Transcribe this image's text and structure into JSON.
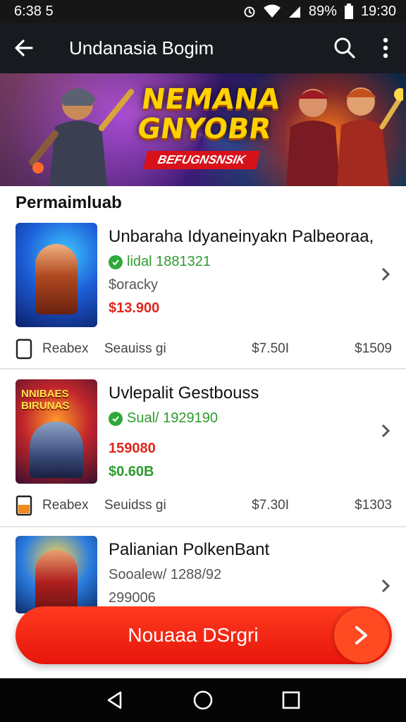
{
  "status": {
    "time_left": "6:38 5",
    "battery": "89%",
    "time_right": "19:30"
  },
  "appbar": {
    "title": "Undanasia Bogim",
    "back_icon": "arrow-left-icon",
    "search_icon": "search-icon",
    "more_icon": "more-vert-icon"
  },
  "banner": {
    "heading_line1": "NEMANA",
    "heading_line2": "GNYOBR",
    "tagline": "BEFUGNSNSIK"
  },
  "section": {
    "title": "Permaimluab"
  },
  "products": [
    {
      "name": "Unbaraha Idyaneinyakn Palbeoraa,",
      "line1": "lidal 1881321",
      "line2": "$oracky",
      "price": "$13.900",
      "meta": [
        "Reabex",
        "Seauiss gi",
        "$7.50I",
        "$1509"
      ]
    },
    {
      "name": "Uvlepalit Gestbouss",
      "line1": "Sual/ 1929190",
      "price": "159080",
      "price2": "$0.60B",
      "thumb_text": "NNIBAES BIRUNAS",
      "meta": [
        "Reabex",
        "Seuidss gi",
        "$7.30I",
        "$1303"
      ]
    },
    {
      "name": "Palianian PolkenBant",
      "line1": "Sooalew/ 1288/92",
      "line2": "299006"
    }
  ],
  "cta": {
    "label": "Nouaaa DSrgri"
  },
  "colors": {
    "accent": "#e6150b",
    "green": "#2e9b2e",
    "appbar": "#171a1f"
  }
}
